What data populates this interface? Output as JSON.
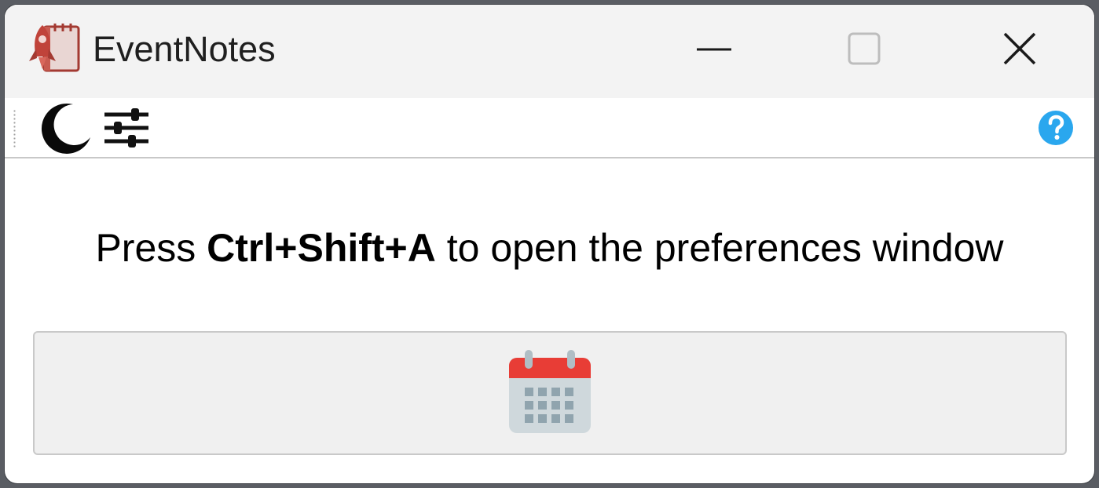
{
  "window": {
    "title": "EventNotes",
    "icon": "rocket-notebook-icon"
  },
  "titlebar": {
    "minimize_icon": "minimize-icon",
    "maximize_icon": "maximize-icon",
    "close_icon": "close-icon"
  },
  "toolbar": {
    "items": [
      {
        "icon": "moon-icon"
      },
      {
        "icon": "sliders-icon"
      }
    ],
    "help_icon": "help-icon",
    "help_color": "#2aa7ee"
  },
  "main": {
    "hint_prefix": "Press ",
    "hint_shortcut": "Ctrl+Shift+A",
    "hint_suffix": " to open the preferences window",
    "button_icon": "calendar-icon",
    "calendar_header_color": "#e83d36",
    "calendar_body_color": "#cfd8dc"
  }
}
